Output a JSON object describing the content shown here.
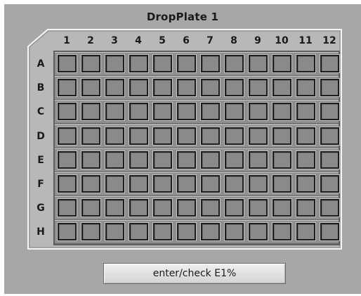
{
  "plate": {
    "title": "DropPlate 1",
    "columns": [
      "1",
      "2",
      "3",
      "4",
      "5",
      "6",
      "7",
      "8",
      "9",
      "10",
      "11",
      "12"
    ],
    "rows": [
      "A",
      "B",
      "C",
      "D",
      "E",
      "F",
      "G",
      "H"
    ]
  },
  "action": {
    "label": "enter/check E1%"
  },
  "colors": {
    "panel": "#a7a7a7",
    "well": "#8a8a8a",
    "well_border": "#1e1e1e"
  }
}
